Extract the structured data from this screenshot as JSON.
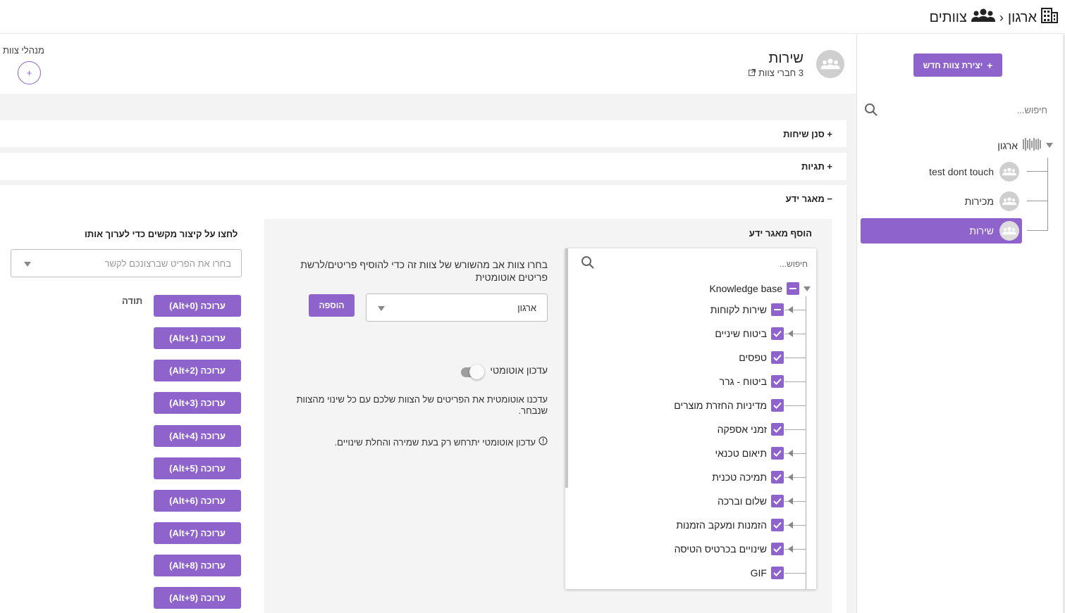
{
  "breadcrumb": {
    "root": "ארגון",
    "separator": "›",
    "current": "צוותים"
  },
  "sidebar": {
    "create_button": "יצירת צוות חדש",
    "search_placeholder": "חיפוש...",
    "root_label": "ארגון",
    "teams": [
      {
        "name": "test dont touch",
        "active": false
      },
      {
        "name": "מכירות",
        "active": false
      },
      {
        "name": "שירות",
        "active": true
      }
    ]
  },
  "team": {
    "name": "שירות",
    "members": "3 חברי צוות",
    "managers_label": "מנהלי צוות",
    "add_manager": "+"
  },
  "sections": {
    "filter": "+ סנן שיחות",
    "tags": "+ תגיות",
    "kb": "− מאגר ידע"
  },
  "kb": {
    "add_title": "הוסף מאגר ידע",
    "search_placeholder": "חיפוש...",
    "root": {
      "label": "Knowledge base",
      "state": "partial"
    },
    "items": [
      {
        "label": "שירות לקוחות",
        "state": "partial",
        "expandable": true
      },
      {
        "label": "ביטוח שיניים",
        "state": "checked",
        "expandable": true
      },
      {
        "label": "טפסים",
        "state": "checked",
        "expandable": false
      },
      {
        "label": "ביטוח - גרר",
        "state": "checked",
        "expandable": false
      },
      {
        "label": "מדיניות החזרת מוצרים",
        "state": "checked",
        "expandable": false
      },
      {
        "label": "זמני אספקה",
        "state": "checked",
        "expandable": false
      },
      {
        "label": "תיאום טכנאי",
        "state": "checked",
        "expandable": true
      },
      {
        "label": "תמיכה טכנית",
        "state": "checked",
        "expandable": true
      },
      {
        "label": "שלום וברכה",
        "state": "checked",
        "expandable": true
      },
      {
        "label": "הזמנות ומעקב הזמנות",
        "state": "checked",
        "expandable": true
      },
      {
        "label": "שינויים בכרטיס הטיסה",
        "state": "checked",
        "expandable": true
      },
      {
        "label": "GIF",
        "state": "checked",
        "expandable": false
      }
    ],
    "parent_desc": "בחרו צוות אב מהשורש של צוות זה כדי להוסיף פריטים/לרשת פריטים אוטומטית",
    "parent_value": "ארגון",
    "add_button": "הוספה",
    "auto_update_label": "עדכון אוטומטי",
    "auto_update_on": false,
    "auto_update_desc": "עדכנו אוטומטית את הפריטים של הצוות שלכם עם כל שינוי מהצוות שנבחר.",
    "auto_update_note": "עדכון אוטומטי יתרחש רק בעת שמירה והחלת שינויים."
  },
  "shortcuts": {
    "title": "לחצו על קיצור מקשים כדי לערוך אותו",
    "select_placeholder": "בחרו את הפריט שברצונכם לקשר",
    "buttons": [
      "ערוכה (Alt+0)",
      "ערוכה (Alt+1)",
      "ערוכה (Alt+2)",
      "ערוכה (Alt+3)",
      "ערוכה (Alt+4)",
      "ערוכה (Alt+5)",
      "ערוכה (Alt+6)",
      "ערוכה (Alt+7)",
      "ערוכה (Alt+8)",
      "ערוכה (Alt+9)"
    ],
    "value0": "תודה"
  },
  "colors": {
    "accent": "#8e63cc",
    "background": "#f3f3f3"
  }
}
